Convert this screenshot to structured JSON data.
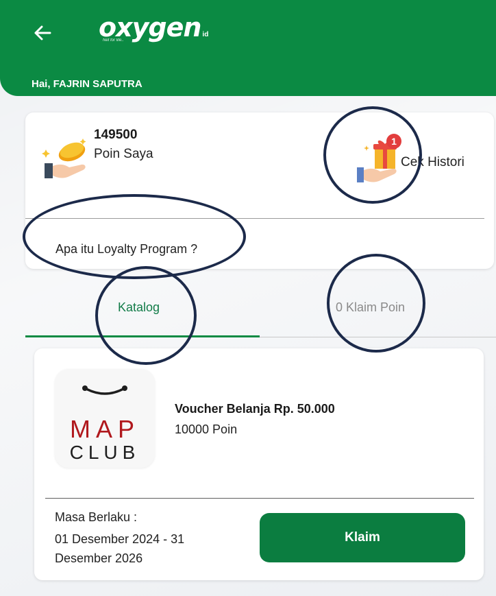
{
  "header": {
    "logo_text": "oxygen",
    "logo_suffix": "id",
    "logo_tagline": "Net for life..",
    "greeting": "Hai, FAJRIN SAPUTRA",
    "icons": {
      "back": "arrow-left-icon"
    }
  },
  "points": {
    "value": "149500",
    "label": "Poin Saya",
    "history_label": "Cek Histori",
    "history_badge": "1",
    "loyalty_link": "Apa itu Loyalty Program ?",
    "icons": {
      "points": "coin-hand-icon",
      "history": "gift-hand-icon"
    }
  },
  "tabs": [
    {
      "label": "Katalog",
      "active": true
    },
    {
      "label": "0 Klaim Poin",
      "active": false
    }
  ],
  "voucher": {
    "brand_line1": "MAP",
    "brand_line2": "CLUB",
    "title": "Voucher Belanja Rp. 50.000",
    "cost": "10000 Poin",
    "validity_label": "Masa Berlaku :",
    "validity_dates": "01 Desember 2024 - 31 Desember 2026",
    "claim_label": "Klaim"
  },
  "colors": {
    "brand_green": "#0b8a43",
    "tab_active_text": "#127c48",
    "badge_red": "#e23d3d",
    "map_red": "#b0181d",
    "annotation": "#1c2a4a"
  }
}
